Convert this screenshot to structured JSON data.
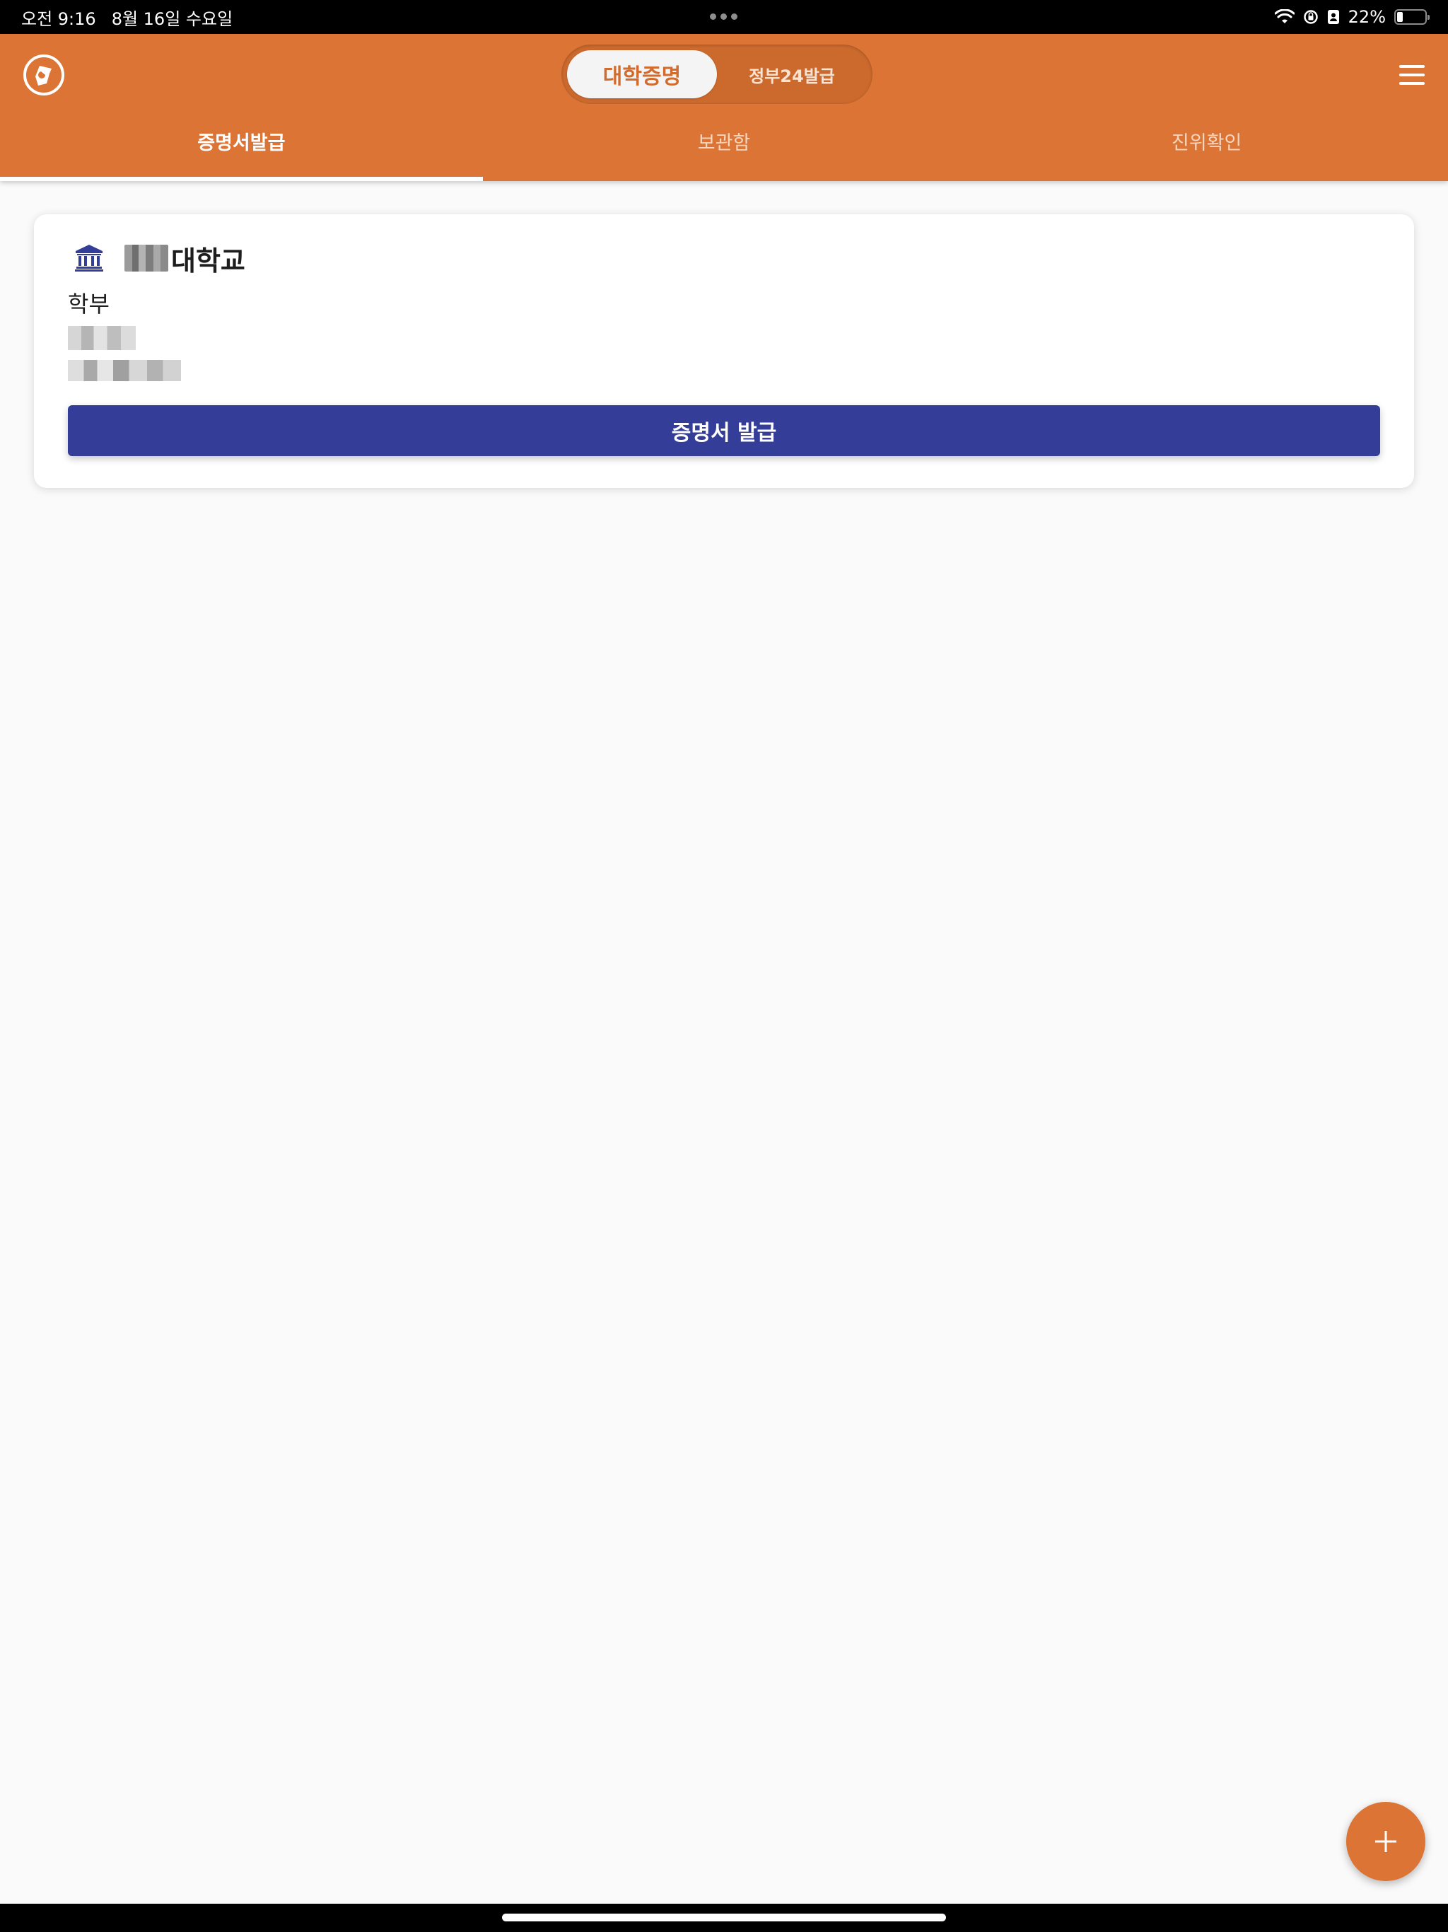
{
  "status_bar": {
    "time": "오전 9:16",
    "date": "8월 16일 수요일",
    "battery_percent": "22%",
    "battery_level": 0.22
  },
  "header": {
    "segments": [
      {
        "label": "대학증명",
        "selected": true
      },
      {
        "label": "정부24발급",
        "selected": false
      }
    ],
    "tabs": [
      {
        "label": "증명서발급",
        "active": true
      },
      {
        "label": "보관함",
        "active": false
      },
      {
        "label": "진위확인",
        "active": false
      }
    ]
  },
  "card": {
    "university_suffix": "대학교",
    "department": "학부",
    "issue_button_label": "증명서 발급"
  },
  "fab": {
    "label": "+"
  },
  "colors": {
    "primary": "#db7434",
    "button": "#343d98",
    "background": "#fafafa"
  }
}
